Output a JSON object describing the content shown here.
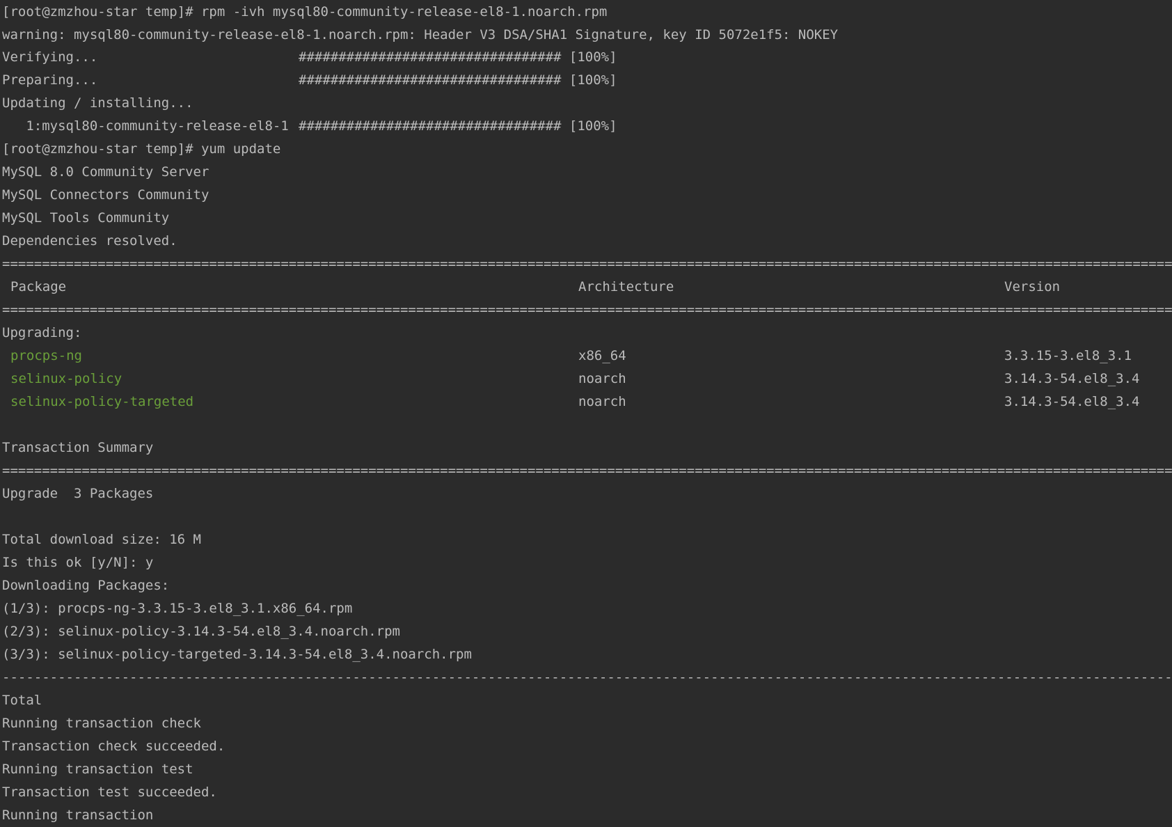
{
  "colors": {
    "background": "#2b2b2b",
    "text": "#bbbbbb",
    "package_name": "#6a9f3a"
  },
  "lines": {
    "cmd_rpm": "[root@zmzhou-star temp]# rpm -ivh mysql80-community-release-el8-1.noarch.rpm",
    "warning": "warning: mysql80-community-release-el8-1.noarch.rpm: Header V3 DSA/SHA1 Signature, key ID 5072e1f5: NOKEY",
    "verifying": "Verifying...",
    "preparing": "Preparing...",
    "updating": "Updating / installing...",
    "install_item": "   1:mysql80-community-release-el8-1",
    "progress_bar": "################################# [100%]",
    "cmd_yum": "[root@zmzhou-star temp]# yum update",
    "repo_server": "MySQL 8.0 Community Server",
    "repo_connectors": "MySQL Connectors Community",
    "repo_tools": "MySQL Tools Community",
    "deps": "Dependencies resolved.",
    "upgrading": "Upgrading:",
    "summary": "Transaction Summary",
    "upgrade_count": "Upgrade  3 Packages",
    "download_size": "Total download size: 16 M",
    "prompt_ok": "Is this ok [y/N]: y",
    "downloading": "Downloading Packages:",
    "dl_1": "(1/3): procps-ng-3.3.15-3.el8_3.1.x86_64.rpm",
    "dl_2": "(2/3): selinux-policy-3.14.3-54.el8_3.4.noarch.rpm",
    "dl_3": "(3/3): selinux-policy-targeted-3.14.3-54.el8_3.4.noarch.rpm",
    "total": "Total",
    "check_run": "Running transaction check",
    "check_ok": "Transaction check succeeded.",
    "test_run": "Running transaction test",
    "test_ok": "Transaction test succeeded.",
    "running": "Running transaction"
  },
  "table": {
    "headers": {
      "package": "Package",
      "architecture": "Architecture",
      "version": "Version"
    },
    "rows": [
      {
        "package": "procps-ng",
        "arch": "x86_64",
        "version": "3.3.15-3.el8_3.1"
      },
      {
        "package": "selinux-policy",
        "arch": "noarch",
        "version": "3.14.3-54.el8_3.4"
      },
      {
        "package": "selinux-policy-targeted",
        "arch": "noarch",
        "version": "3.14.3-54.el8_3.4"
      }
    ]
  }
}
